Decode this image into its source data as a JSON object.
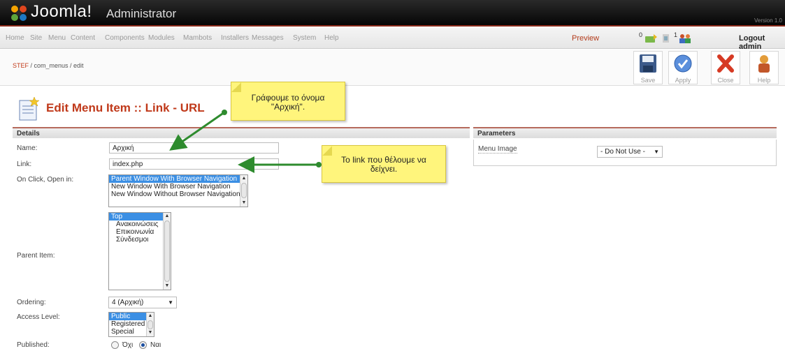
{
  "header": {
    "logo_text": "Joomla!",
    "logo_sub": "Administrator",
    "version_text": "Version 1.0"
  },
  "menubar": {
    "items": [
      "Home",
      "Site",
      "Menu",
      "Content",
      "Components",
      "Modules",
      "Mambots",
      "Installers",
      "Messages",
      "System",
      "Help"
    ],
    "preview": "Preview",
    "messages_count": "0",
    "users_count": "1",
    "logout": "Logout admin"
  },
  "breadcrumb": {
    "site": "STEF",
    "path": " / com_menus / edit"
  },
  "toolbar": {
    "save": "Save",
    "apply": "Apply",
    "close": "Close",
    "help": "Help"
  },
  "page_title": "Edit Menu Item :: Link - URL",
  "details": {
    "heading": "Details",
    "name_label": "Name:",
    "name_value": "Αρχική",
    "link_label": "Link:",
    "link_value": "index.php",
    "onclick_label": "On Click, Open in:",
    "onclick_options": [
      "Parent Window With Browser Navigation",
      "New Window With Browser Navigation",
      "New Window Without Browser Navigation"
    ],
    "parent_label": "Parent Item:",
    "parent_options": [
      "Top",
      "Ανακοινώσεις",
      "Επικοινωνία",
      "Σύνδεσμοι"
    ],
    "ordering_label": "Ordering:",
    "ordering_value": "4 (Αρχική)",
    "access_label": "Access Level:",
    "access_options": [
      "Public",
      "Registered",
      "Special"
    ],
    "published_label": "Published:",
    "published_no": "Όχι",
    "published_yes": "Ναι"
  },
  "parameters": {
    "heading": "Parameters",
    "menu_image_label": "Menu Image",
    "menu_image_value": "- Do Not Use -"
  },
  "callouts": {
    "name_note_line1": "Γράφουμε το όνομα",
    "name_note_line2": "\"Αρχική\".",
    "link_note_line1": "Το link που θέλουμε να",
    "link_note_line2": "δείχνει."
  },
  "colors": {
    "accent": "#c0391a",
    "arrow": "#2e8b2e",
    "callout": "#fff57c",
    "selection": "#3b8fe4"
  }
}
